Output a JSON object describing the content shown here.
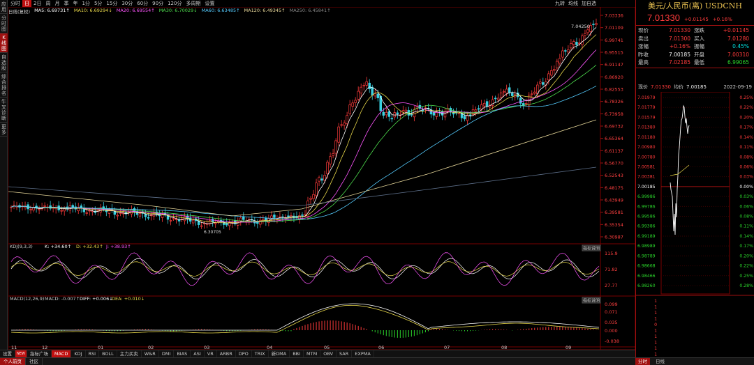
{
  "left_tabs": [
    "应用",
    "分时图",
    "K线图",
    "自选股",
    "综合排名",
    "牛叉诊断",
    "更多"
  ],
  "periods": [
    "分时",
    "日",
    "2日",
    "周",
    "月",
    "季",
    "年",
    "1分",
    "5分",
    "15分",
    "30分",
    "60分",
    "90分",
    "120分",
    "多周期",
    "设置"
  ],
  "active_period": "日",
  "top_right": [
    "九转",
    "均线",
    "加自选"
  ],
  "ma_bar": {
    "label": "日线(复权)",
    "items": [
      {
        "text": "MA5: 6.69731↑",
        "color": "#ffffff"
      },
      {
        "text": "MA10: 6.69294↓",
        "color": "#e8d84a"
      },
      {
        "text": "MA20: 6.69554↑",
        "color": "#ff55ff"
      },
      {
        "text": "MA30: 6.70029↓",
        "color": "#4cd94c"
      },
      {
        "text": "MA60: 6.63485↑",
        "color": "#55ccff"
      },
      {
        "text": "MA120: 6.49345↑",
        "color": "#e8d89a"
      },
      {
        "text": "MA250: 6.45841↑",
        "color": "#888888"
      }
    ]
  },
  "main_axis": [
    "7.03336",
    "7.01109",
    "6.99741",
    "6.95515",
    "6.91147",
    "6.86920",
    "6.82553",
    "6.78326",
    "6.73958",
    "6.69732",
    "6.65364",
    "6.61137",
    "6.56770",
    "6.52543",
    "6.48175",
    "6.43949",
    "6.39581",
    "6.35354",
    "6.30987"
  ],
  "high_label": "7.04250",
  "low_label": "6.30705",
  "kdj": {
    "label": "KDJ(9,3,3)",
    "k": "K: +34.60↑",
    "d": "D: +32.43↑",
    "j": "J: +38.93↑",
    "axis": [
      "115.9",
      "71.82",
      "27.77"
    ]
  },
  "macd": {
    "label": "MACD(12,26,9)",
    "macd": "MACD: -0.007↑",
    "diff": "DIFF: +0.006↓",
    "dea": "DEA: +0.010↓",
    "axis": [
      "0.099",
      "0.071",
      "0.035",
      "0.000",
      "-0.038"
    ]
  },
  "explain_btn": "指标说明",
  "months": [
    "11",
    "12",
    "01",
    "02",
    "03",
    "04",
    "05",
    "06",
    "07",
    "08",
    "09"
  ],
  "indicator_tabs": [
    "设置",
    "NEW",
    "指标广场",
    "MACD",
    "KDJ",
    "RSI",
    "BOLL",
    "主力买卖",
    "W&R",
    "DMI",
    "BIAS",
    "ASI",
    "VR",
    "ARBR",
    "DPO",
    "TRIX",
    "新DMA",
    "BBI",
    "MTM",
    "OBV",
    "SAR",
    "EXPMA"
  ],
  "active_indicator": "MACD",
  "status_tabs": [
    "个人前页",
    "社区"
  ],
  "status_right": [
    "分时",
    "日线"
  ],
  "panel": {
    "title": "美元/人民币(离) USDCNH",
    "price": "7.01330",
    "change": "+0.01145",
    "pct": "+0.16%",
    "rows": [
      {
        "k": "现价",
        "v": "7.01330",
        "vc": "red",
        "k2": "涨跌",
        "v2": "+0.01145",
        "v2c": "red"
      },
      {
        "k": "卖出",
        "v": "7.01300",
        "vc": "red",
        "k2": "买入",
        "v2": "7.01280",
        "v2c": "red"
      },
      {
        "k": "涨幅",
        "v": "+0.16%",
        "vc": "red",
        "k2": "振幅",
        "v2": "0.45%",
        "v2c": "cyan"
      },
      {
        "k": "昨收",
        "v": "7.00185",
        "vc": "white",
        "k2": "开盘",
        "v2": "7.00310",
        "v2c": "red"
      },
      {
        "k": "最高",
        "v": "7.02185",
        "vc": "red",
        "k2": "最低",
        "v2": "6.99065",
        "v2c": "green"
      }
    ],
    "mini_header": {
      "price_label": "现价",
      "price": "7.01330",
      "avg_label": "均价",
      "avg": "7.00185",
      "date": "2022-09-19"
    },
    "mini_left": [
      "7.01979",
      "7.01779",
      "7.01579",
      "7.01380",
      "7.01180",
      "7.00980",
      "7.00780",
      "7.00581",
      "7.00381",
      "7.00185",
      "6.99986",
      "6.99786",
      "6.99586",
      "6.99386",
      "6.99189",
      "6.98989",
      "6.98789",
      "6.98668",
      "6.98466",
      "6.98260"
    ],
    "mini_right": [
      "0.25%",
      "0.22%",
      "0.20%",
      "0.17%",
      "0.14%",
      "0.11%",
      "0.08%",
      "0.06%",
      "0.03%",
      "0.00%",
      "0.03%",
      "0.06%",
      "0.08%",
      "0.11%",
      "0.14%",
      "0.17%",
      "0.20%",
      "0.22%",
      "0.25%",
      "0.28%"
    ],
    "vol_axis": [
      "1",
      "1",
      "1",
      "1",
      "0",
      "1",
      "1",
      "1",
      "1",
      "1"
    ]
  }
}
